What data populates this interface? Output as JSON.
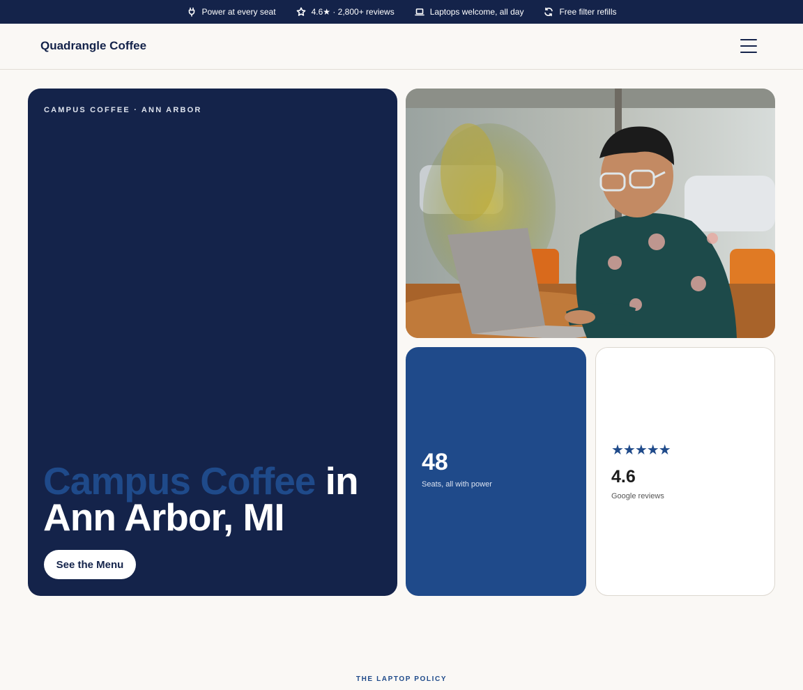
{
  "topbar": {
    "items": [
      {
        "icon": "plug-icon",
        "label": "Power at every seat"
      },
      {
        "icon": "star-icon",
        "label": "4.6★ · 2,800+ reviews"
      },
      {
        "icon": "laptop-icon",
        "label": "Laptops welcome, all day"
      },
      {
        "icon": "refresh-icon",
        "label": "Free filter refills"
      }
    ]
  },
  "header": {
    "brand": "Quadrangle Coffee",
    "menu_icon": "hamburger-menu-icon"
  },
  "hero": {
    "eyebrow": "CAMPUS COFFEE · ANN ARBOR",
    "title_accent": "Campus Coffee",
    "title_rest": " in Ann Arbor, MI",
    "cta_label": "See the Menu"
  },
  "photo": {
    "subject": "man with glasses working on laptop in cafe"
  },
  "stats": {
    "seats": {
      "value": "48",
      "label": "Seats, all with power"
    },
    "reviews": {
      "stars": "★★★★★",
      "rating_value": 5,
      "value": "4.6",
      "label": "Google reviews"
    }
  },
  "next_section": {
    "eyebrow": "THE LAPTOP POLICY"
  },
  "colors": {
    "navy": "#14234a",
    "accent_blue": "#1f4a8a",
    "background": "#faf8f5"
  }
}
